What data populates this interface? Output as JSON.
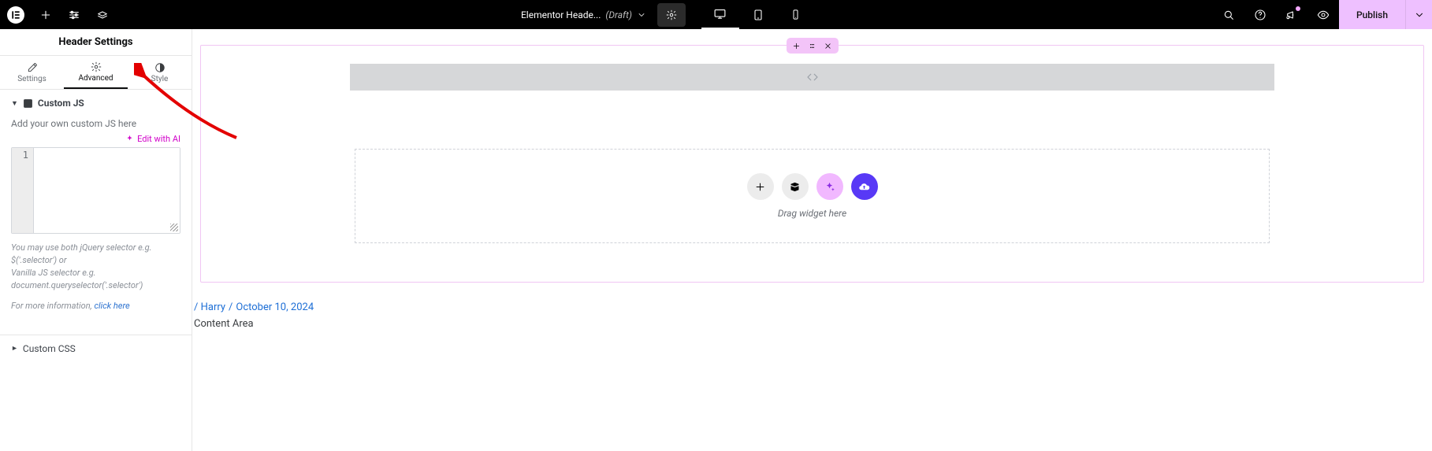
{
  "topbar": {
    "doc_title": "Elementor Heade...",
    "doc_status": "(Draft)",
    "publish_label": "Publish"
  },
  "sidebar": {
    "panel_title": "Header Settings",
    "tabs": {
      "settings": "Settings",
      "advanced": "Advanced",
      "style": "Style"
    },
    "custom_js": {
      "heading": "Custom JS",
      "desc": "Add your own custom JS here",
      "ai_link": "Edit with AI",
      "line_number": "1",
      "hint_line1": "You may use both jQuery selector e.g. $('.selector') or",
      "hint_line2": "Vanilla JS selector e.g.",
      "hint_line3": "document.queryselector('.selector')",
      "more_prefix": "For more information, ",
      "more_link": "click here"
    },
    "custom_css": {
      "heading": "Custom CSS"
    }
  },
  "canvas": {
    "drop_text": "Drag widget here",
    "meta_author_prefix": "/ ",
    "meta_author": "Harry",
    "meta_date": "October 10, 2024",
    "content_area_label": "Content Area"
  }
}
